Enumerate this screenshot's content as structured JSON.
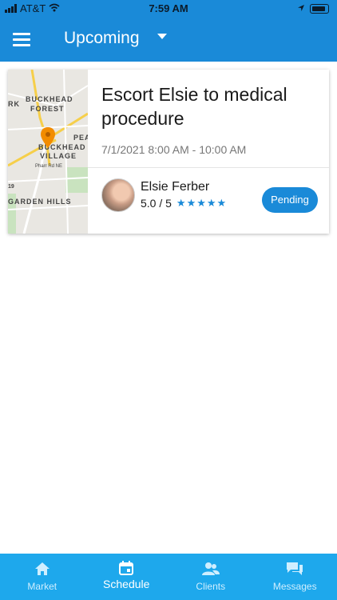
{
  "status_bar": {
    "carrier": "AT&T",
    "time": "7:59 AM"
  },
  "header": {
    "title": "Upcoming"
  },
  "map": {
    "labels": [
      "BUCKHEAD",
      "FOREST",
      "BUCKHEAD",
      "VILLAGE",
      "GARDEN HILLS",
      "PEA",
      "RK",
      "Pharr Rd NE",
      "19"
    ]
  },
  "card": {
    "title": "Escort Elsie to medical procedure",
    "datetime": "7/1/2021 8:00 AM - 10:00 AM",
    "client": {
      "name": "Elsie Ferber",
      "rating_text": "5.0 / 5",
      "rating": 5,
      "stars": "★★★★★"
    },
    "status_button": "Pending"
  },
  "bottom_nav": {
    "items": [
      {
        "label": "Market",
        "icon": "home-icon"
      },
      {
        "label": "Schedule",
        "icon": "calendar-icon",
        "active": true
      },
      {
        "label": "Clients",
        "icon": "users-icon"
      },
      {
        "label": "Messages",
        "icon": "chat-icon"
      }
    ]
  },
  "colors": {
    "primary": "#1a8ad8",
    "nav": "#1ea8ec",
    "pin": "#f28c00"
  }
}
